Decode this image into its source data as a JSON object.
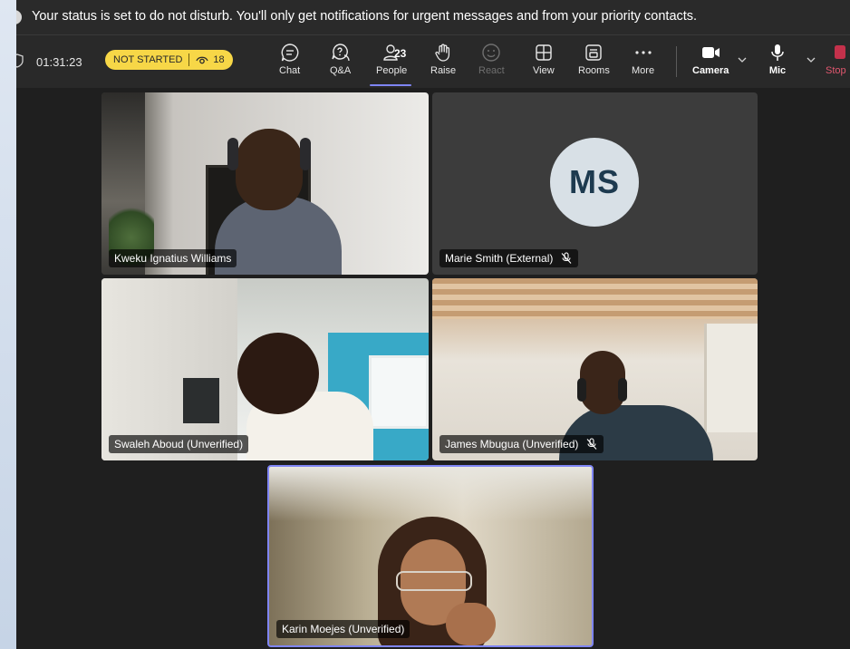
{
  "notification": {
    "message": "Your status is set to do not disturb. You'll only get notifications for urgent messages and from your priority contacts."
  },
  "meeting": {
    "timer": "01:31:23",
    "status": "NOT STARTED",
    "viewers": "18"
  },
  "toolbar": {
    "chat": "Chat",
    "qa": "Q&A",
    "people": "People",
    "people_count": "23",
    "raise": "Raise",
    "react": "React",
    "view": "View",
    "rooms": "Rooms",
    "more": "More",
    "camera": "Camera",
    "mic": "Mic",
    "stop": "Stop"
  },
  "participants": [
    {
      "name": "Kweku Ignatius Williams"
    },
    {
      "name": "Marie Smith (External)",
      "initials": "MS"
    },
    {
      "name": "Swaleh Aboud (Unverified)"
    },
    {
      "name": "James Mbugua (Unverified)"
    },
    {
      "name": "Karin Moejes (Unverified)"
    }
  ],
  "colors": {
    "status_pill": "#f7d747",
    "accent": "#7f85f5",
    "stop": "#c4314b",
    "app_bg": "#1f1f1f"
  }
}
